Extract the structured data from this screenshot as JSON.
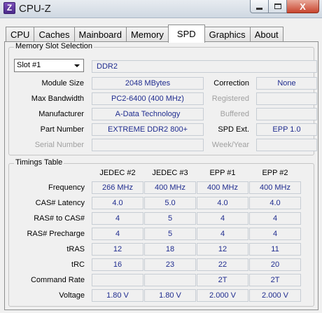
{
  "window": {
    "title": "CPU-Z",
    "icon_letter": "Z",
    "close_glyph": "X"
  },
  "tabs": [
    {
      "label": "CPU"
    },
    {
      "label": "Caches"
    },
    {
      "label": "Mainboard"
    },
    {
      "label": "Memory"
    },
    {
      "label": "SPD",
      "active": true
    },
    {
      "label": "Graphics"
    },
    {
      "label": "About"
    }
  ],
  "memory_slot": {
    "legend": "Memory Slot Selection",
    "slot_selected": "Slot #1",
    "type": "DDR2",
    "module_size_label": "Module Size",
    "module_size": "2048 MBytes",
    "max_bandwidth_label": "Max Bandwidth",
    "max_bandwidth": "PC2-6400 (400 MHz)",
    "manufacturer_label": "Manufacturer",
    "manufacturer": "A-Data Technology",
    "part_number_label": "Part Number",
    "part_number": "EXTREME DDR2 800+",
    "serial_number_label": "Serial Number",
    "serial_number": "",
    "correction_label": "Correction",
    "correction": "None",
    "registered_label": "Registered",
    "registered": "",
    "buffered_label": "Buffered",
    "buffered": "",
    "spd_ext_label": "SPD Ext.",
    "spd_ext": "EPP 1.0",
    "week_year_label": "Week/Year",
    "week_year": ""
  },
  "timings": {
    "legend": "Timings Table",
    "columns": [
      "JEDEC #2",
      "JEDEC #3",
      "EPP #1",
      "EPP #2"
    ],
    "rows": [
      {
        "label": "Frequency",
        "values": [
          "266 MHz",
          "400 MHz",
          "400 MHz",
          "400 MHz"
        ]
      },
      {
        "label": "CAS# Latency",
        "values": [
          "4.0",
          "5.0",
          "4.0",
          "4.0"
        ]
      },
      {
        "label": "RAS# to CAS#",
        "values": [
          "4",
          "5",
          "4",
          "4"
        ]
      },
      {
        "label": "RAS# Precharge",
        "values": [
          "4",
          "5",
          "4",
          "4"
        ]
      },
      {
        "label": "tRAS",
        "values": [
          "12",
          "18",
          "12",
          "11"
        ]
      },
      {
        "label": "tRC",
        "values": [
          "16",
          "23",
          "22",
          "20"
        ]
      },
      {
        "label": "Command Rate",
        "values": [
          "",
          "",
          "2T",
          "2T"
        ]
      },
      {
        "label": "Voltage",
        "values": [
          "1.80 V",
          "1.80 V",
          "2.000 V",
          "2.000 V"
        ]
      }
    ]
  },
  "colors": {
    "value_text": "#1f2c8f",
    "dim_label": "#a0a0a0"
  }
}
